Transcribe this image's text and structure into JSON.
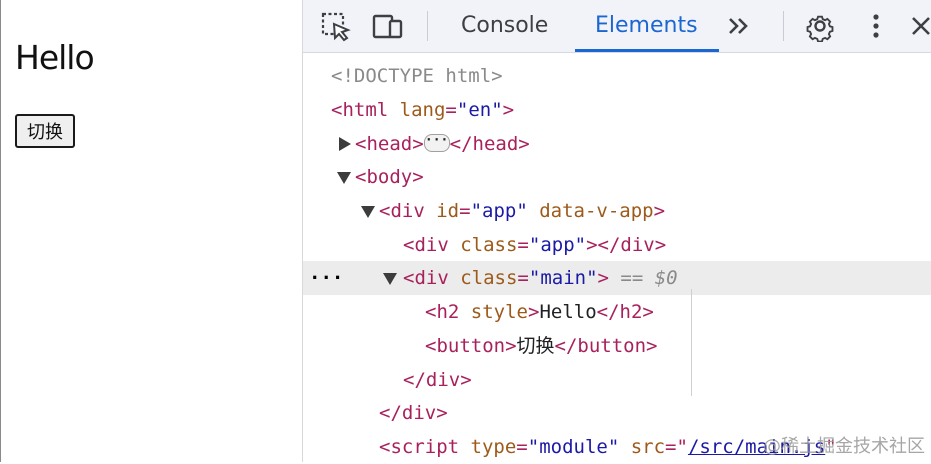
{
  "preview": {
    "heading": "Hello",
    "button_label": "切换"
  },
  "devtools": {
    "tabs": [
      {
        "label": "Console",
        "active": false
      },
      {
        "label": "Elements",
        "active": true
      }
    ],
    "more_tabs": "»",
    "icons": [
      "inspect-element-icon",
      "device-toolbar-icon",
      "more-tabs-icon",
      "settings-gear-icon",
      "kebab-menu-icon",
      "close-icon"
    ],
    "colors": {
      "accent": "#1a67d2",
      "tag": "#a8215c",
      "attr": "#9d5a1b",
      "value": "#1a1aa6"
    },
    "dom": {
      "doctype": "<!DOCTYPE html>",
      "html_open": "<html",
      "html_attr": "lang",
      "html_attr_val": "\"en\"",
      "head_open": "<head>",
      "head_close": "</head>",
      "body_open": "<body>",
      "div_app_tag": "<div",
      "div_app_id": "id",
      "div_app_id_val": "\"app\"",
      "div_app_extra": "data-v-app",
      "div_inner_tag": "<div",
      "div_inner_attr": "class",
      "div_inner_val": "\"app\"",
      "div_inner_close": "></div>",
      "div_main_tag": "<div",
      "div_main_attr": "class",
      "div_main_val": "\"main\"",
      "div_main_end": ">",
      "selected_marker": "== $0",
      "h2_tag": "<h2",
      "h2_attr": "style",
      "h2_text": "Hello",
      "h2_close": "</h2>",
      "button_open": "<button>",
      "button_text": "切换",
      "button_close": "</button>",
      "div_close_1": "</div>",
      "div_close_2": "</div>",
      "script_tag": "<script",
      "script_type": "type",
      "script_type_val": "\"module\"",
      "script_src": "src",
      "script_src_val": "/src/main.js"
    }
  },
  "watermark": "@稀土掘金技术社区"
}
